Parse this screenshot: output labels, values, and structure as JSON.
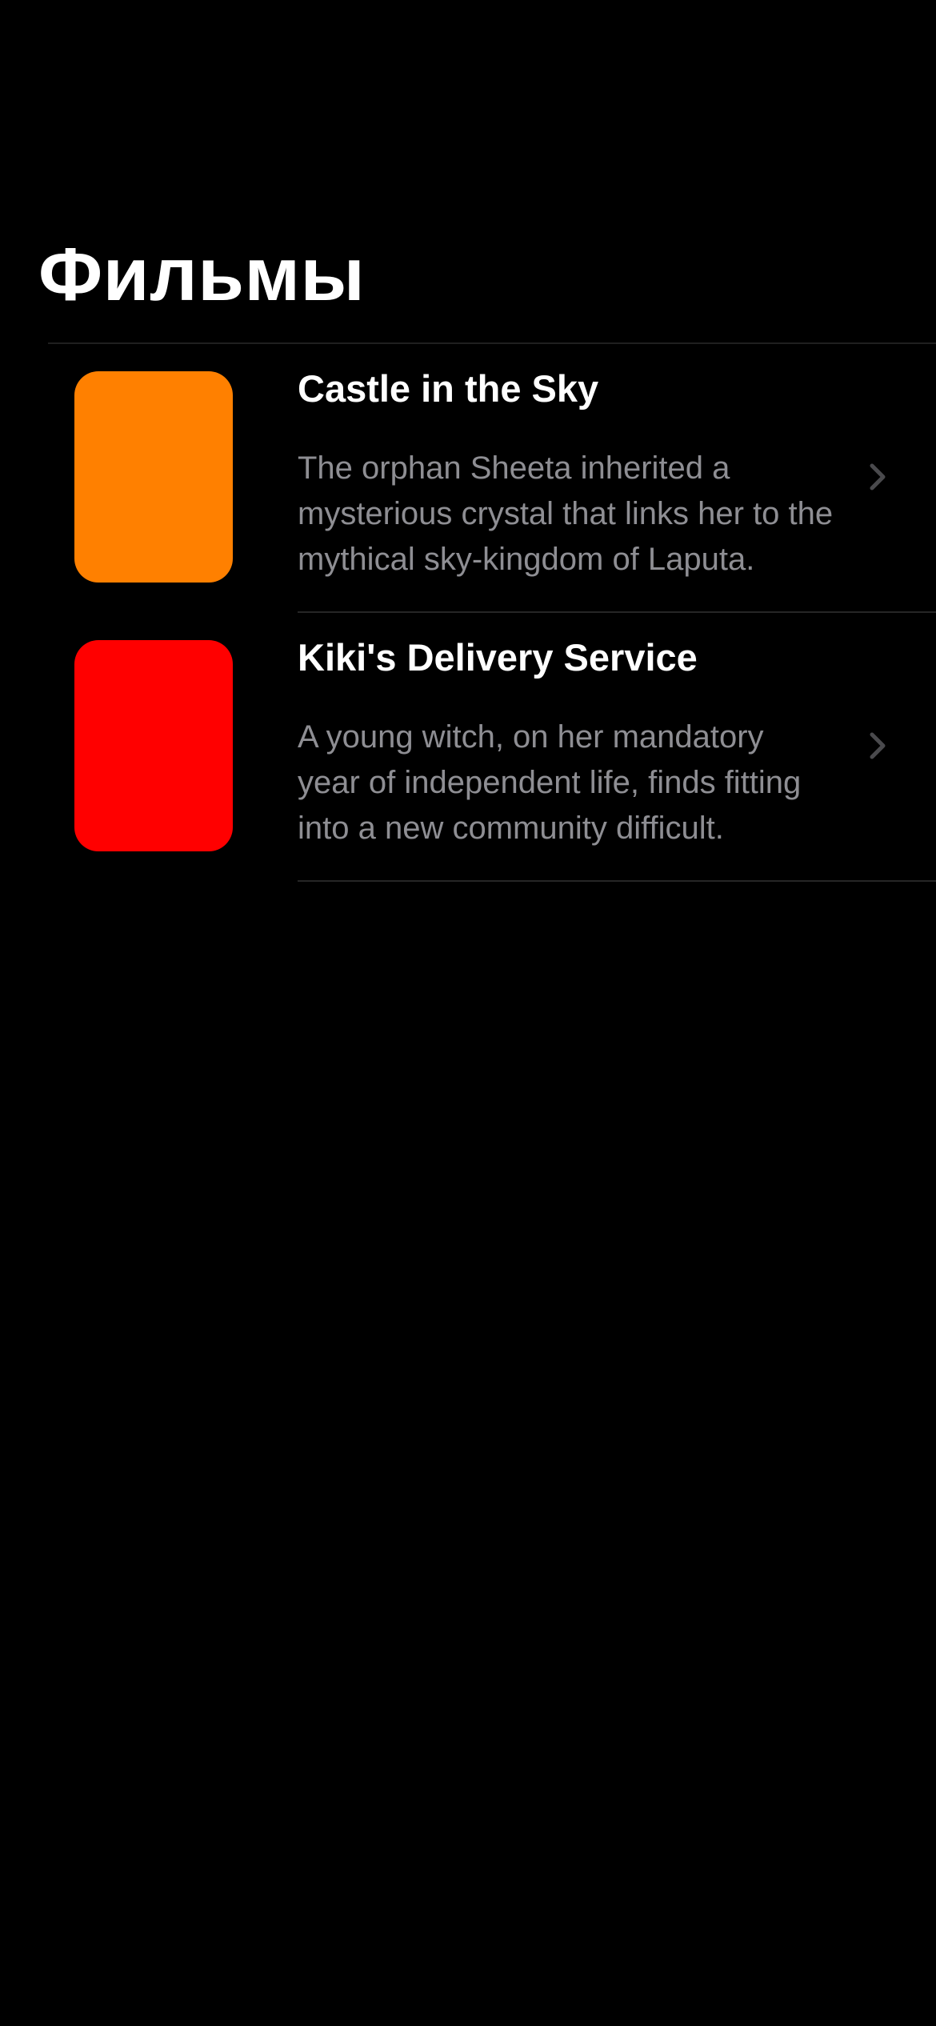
{
  "header": {
    "title": "Фильмы"
  },
  "films": [
    {
      "title": "Castle in the Sky",
      "description": "The orphan Sheeta inherited a mysterious crystal that links her to the mythical sky-kingdom of Laputa.",
      "poster_color": "#FF8000",
      "chevron_icon": "chevron-right-icon"
    },
    {
      "title": "Kiki's Delivery Service",
      "description": "A young witch, on her mandatory year of independent life, finds fitting into a new community difficult.",
      "poster_color": "#FF0000",
      "chevron_icon": "chevron-right-icon"
    }
  ],
  "colors": {
    "background": "#000000",
    "title": "#FFFFFF",
    "description": "#8E8E93",
    "chevron": "#4A4A4D",
    "separator": "#262626"
  }
}
